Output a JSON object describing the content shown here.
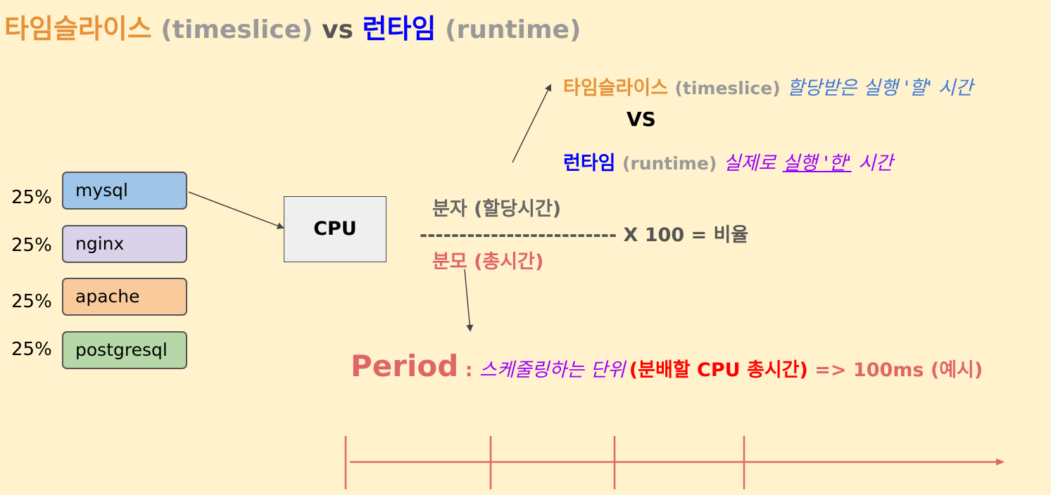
{
  "title": {
    "timeslice_ko": "타임슬라이스",
    "timeslice_en": "(timeslice)",
    "vs": "vs",
    "runtime_ko": "런타임",
    "runtime_en": "(runtime)"
  },
  "processes": [
    {
      "pct": "25%",
      "name": "mysql",
      "color": "#9fc5e8"
    },
    {
      "pct": "25%",
      "name": "nginx",
      "color": "#d9d2e9"
    },
    {
      "pct": "25%",
      "name": "apache",
      "color": "#f9cb9c"
    },
    {
      "pct": "25%",
      "name": "postgresql",
      "color": "#b6d7a8"
    }
  ],
  "cpu": {
    "label": "CPU"
  },
  "definitions": {
    "timeslice_ko": "타임슬라이스",
    "timeslice_en": "(timeslice)",
    "timeslice_desc": "할당받은 실행 '할' 시간",
    "vs": "VS",
    "runtime_ko": "런타임",
    "runtime_en": "(runtime)",
    "runtime_desc_a": "실제로",
    "runtime_desc_b": "실행 '한'",
    "runtime_desc_c": "시간"
  },
  "formula": {
    "numerator": "분자 (할당시간)",
    "line": "------------------------- X 100 = 비율",
    "denominator": "분모 (총시간)"
  },
  "period": {
    "word": "Period",
    "colon": " : ",
    "desc": "스케줄링하는 단위",
    "paren": "(분배할 CPU 총시간)",
    "example": " => 100ms (예시)"
  },
  "colors": {
    "orange": "#e69138",
    "blue": "#0000ff",
    "grey": "#999999",
    "italic_blue": "#3c78d8",
    "purple": "#9900ff",
    "red": "#ff0000",
    "salmon": "#e06666"
  }
}
